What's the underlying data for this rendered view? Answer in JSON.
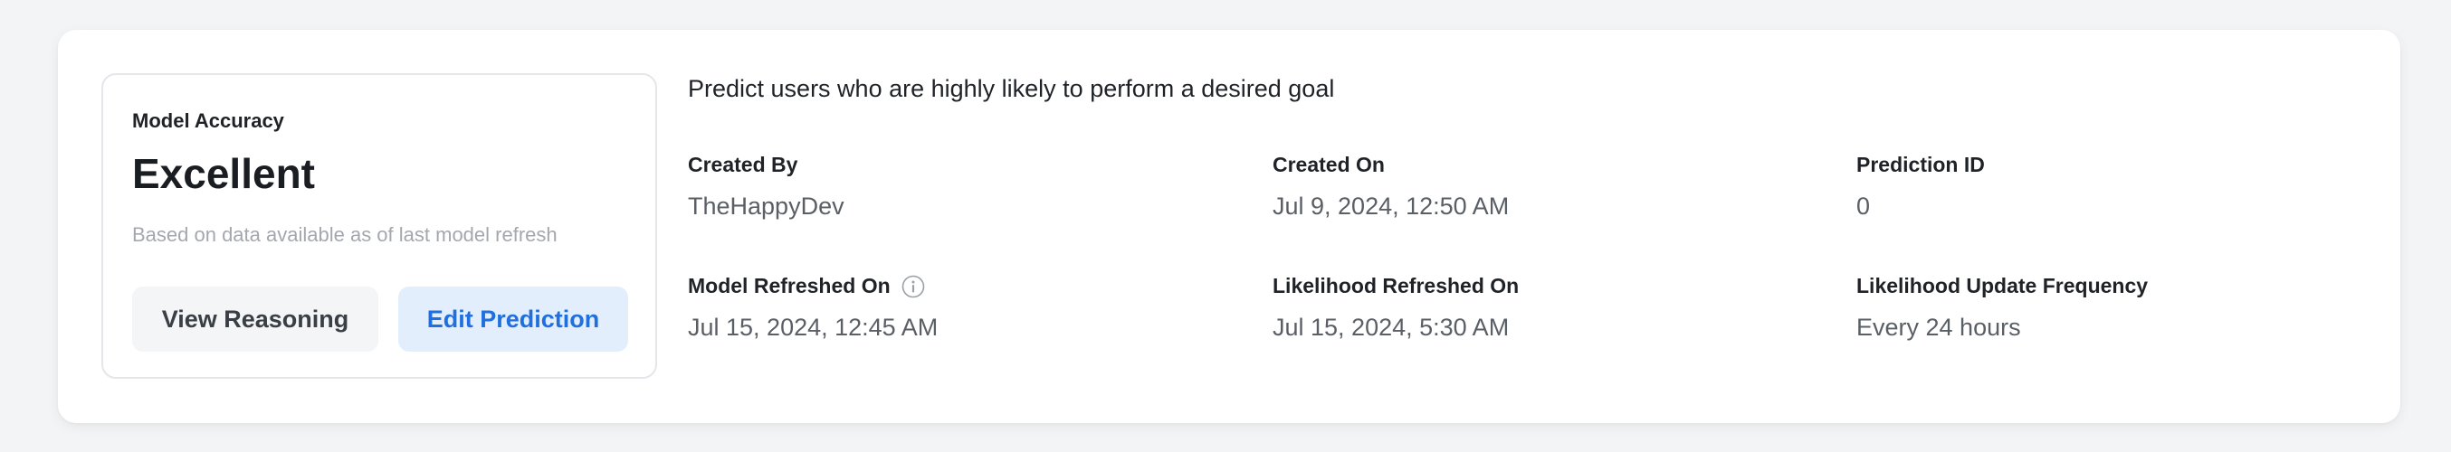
{
  "accuracy": {
    "label": "Model Accuracy",
    "value": "Excellent",
    "note": "Based on data available as of last model refresh",
    "view_reasoning_label": "View Reasoning",
    "edit_prediction_label": "Edit Prediction"
  },
  "description": "Predict users who are highly likely to perform a desired goal",
  "fields": {
    "created_by": {
      "label": "Created By",
      "value": "TheHappyDev"
    },
    "created_on": {
      "label": "Created On",
      "value": "Jul 9, 2024, 12:50 AM"
    },
    "prediction_id": {
      "label": "Prediction ID",
      "value": "0"
    },
    "model_refreshed_on": {
      "label": "Model Refreshed On",
      "value": "Jul 15, 2024, 12:45 AM",
      "icon": "info-icon"
    },
    "likelihood_refreshed_on": {
      "label": "Likelihood Refreshed On",
      "value": "Jul 15, 2024, 5:30 AM"
    },
    "likelihood_update_frequency": {
      "label": "Likelihood Update Frequency",
      "value": "Every 24 hours"
    }
  },
  "colors": {
    "page_background": "#f3f4f6",
    "card_background": "#ffffff",
    "primary_accent": "#1f6fde",
    "primary_button_bg": "#e3eefc",
    "secondary_button_bg": "#f4f5f7"
  }
}
